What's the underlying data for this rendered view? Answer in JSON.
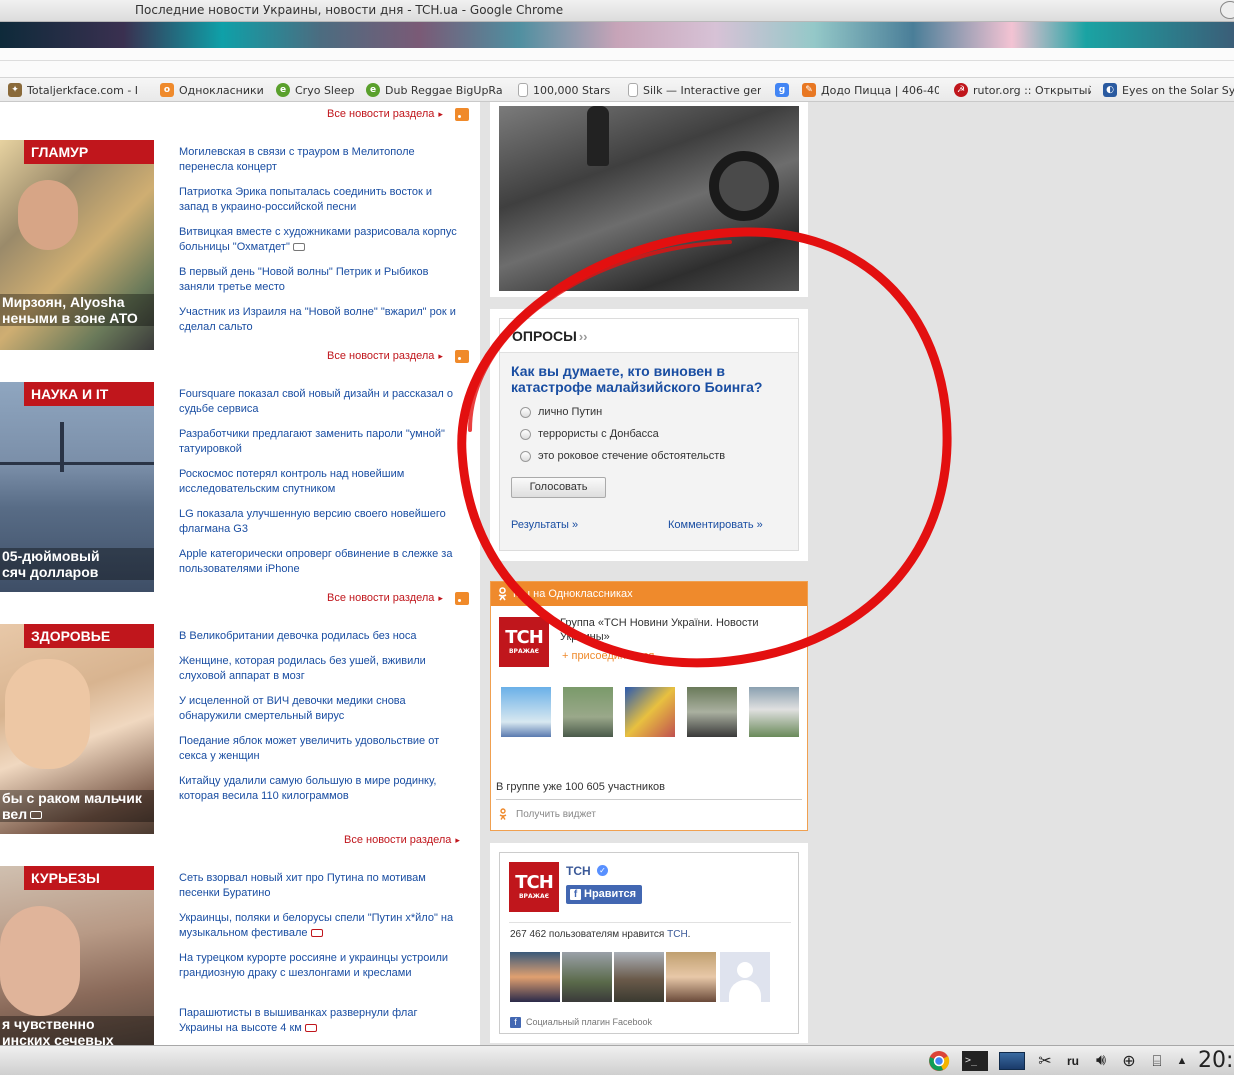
{
  "window": {
    "title": "Последние новости Украины, новости дня - TCH.ua - Google Chrome"
  },
  "bookmarks": [
    {
      "label": "Totaljerkface.com - I",
      "icon": "puzzle-icon",
      "color": "#8a6a3a"
    },
    {
      "label": "Однокласники",
      "icon": "odnoklassniki-icon",
      "color": "#ef8a2c"
    },
    {
      "label": "Cryo Sleep",
      "icon": "e-icon",
      "color": "#5aa02c"
    },
    {
      "label": "Dub Reggae BigUpRa",
      "icon": "e-icon",
      "color": "#5aa02c"
    },
    {
      "label": "100,000 Stars",
      "icon": "page-icon",
      "color": "#bbbbbb"
    },
    {
      "label": "Silk — Interactive gen",
      "icon": "page-icon",
      "color": "#bbbbbb"
    },
    {
      "label": "",
      "icon": "google-icon",
      "color": "#4285f4"
    },
    {
      "label": "Додо Пицца | 406-40",
      "icon": "dodo-icon",
      "color": "#e87722"
    },
    {
      "label": "rutor.org :: Открытый",
      "icon": "rutor-icon",
      "color": "#c0161c"
    },
    {
      "label": "Eyes on the Solar Sys",
      "icon": "nasa-icon",
      "color": "#2a5aa0"
    }
  ],
  "sections": [
    {
      "label": "",
      "caption": [],
      "items": [],
      "all_news": "Все новости раздела"
    },
    {
      "label": "ГЛАМУР",
      "caption": [
        "Мирзоян, Alyosha",
        "неными в зоне АТО"
      ],
      "items": [
        {
          "text": "Могилевская в связи с трауром в Мелитополе перенесла концерт",
          "badge": ""
        },
        {
          "text": "Патриотка Эрика попыталась соединить восток и запад в украино-российской песни",
          "badge": ""
        },
        {
          "text": "Витвицкая вместе с художниками разрисовала корпус больницы \"Охматдет\"",
          "badge": "photo"
        },
        {
          "text": "В первый день \"Новой волны\" Петрик и Рыбиков заняли третье место",
          "badge": ""
        },
        {
          "text": "Участник из Израиля на \"Новой волне\" \"вжарил\" рок и сделал сальто",
          "badge": ""
        }
      ],
      "all_news": "Все новости раздела"
    },
    {
      "label": "НАУКА И IT",
      "caption": [
        "05-дюймовый",
        "сяч долларов"
      ],
      "items": [
        {
          "text": "Foursquare показал свой новый дизайн и рассказал о судьбе сервиса",
          "badge": ""
        },
        {
          "text": "Разработчики предлагают заменить пароли \"умной\" татуировкой",
          "badge": ""
        },
        {
          "text": "Роскосмос потерял контроль над новейшим исследовательским спутником",
          "badge": ""
        },
        {
          "text": "LG показала улучшенную версию своего новейшего флагмана G3",
          "badge": ""
        },
        {
          "text": "Apple категорически опроверг обвинение в слежке за пользователями iPhone",
          "badge": ""
        }
      ],
      "all_news": "Все новости раздела"
    },
    {
      "label": "ЗДОРОВЬЕ",
      "caption": [
        "бы с раком мальчик",
        "вел"
      ],
      "items": [
        {
          "text": "В Великобритании девочка родилась без носа",
          "badge": ""
        },
        {
          "text": "Женщине, которая родилась без ушей, вживили слуховой аппарат в мозг",
          "badge": ""
        },
        {
          "text": "У исцеленной от ВИЧ девочки медики снова обнаружили смертельный вирус",
          "badge": ""
        },
        {
          "text": "Поедание яблок может увеличить удовольствие от секса у женщин",
          "badge": ""
        },
        {
          "text": "Китайцу удалили самую большую в мире родинку, которая весила 110 килограммов",
          "badge": ""
        }
      ],
      "all_news": "Все новости раздела"
    },
    {
      "label": "КУРЬЕЗЫ",
      "caption": [
        "я чувственно",
        "инских сечевых"
      ],
      "items": [
        {
          "text": "Сеть взорвал новый хит про Путина по мотивам песенки Буратино",
          "badge": ""
        },
        {
          "text": "Украинцы, поляки и белорусы спели \"Путин х*йло\" на музыкальном фестивале",
          "badge": "video"
        },
        {
          "text": "На турецком курорте россияне и украинцы устроили грандиозную драку с шезлонгами и креслами",
          "badge": ""
        },
        {
          "text": "Парашютисты в вышиванках развернули флаг Украины на высоте 4 км",
          "badge": "video"
        }
      ],
      "all_news": ""
    }
  ],
  "poll": {
    "title": "ОПРОСЫ",
    "question": "Как вы думаете, кто виновен в катастрофе малайзийского Боинга?",
    "options": [
      "лично Путин",
      "террористы с Донбасса",
      "это роковое стечение обстоятельств"
    ],
    "vote_label": "Голосовать",
    "results_link": "Результаты »",
    "comment_link": "Комментировать »"
  },
  "ok_widget": {
    "header": "Мы на Одноклассниках",
    "group_name": "Группа «ТСН Новини України. Новости Украины»",
    "join_label": "присоединиться",
    "members": "В группе уже 100 605 участников",
    "get_widget": "Получить виджет"
  },
  "logo": {
    "big": "ТСН",
    "small": "ВРАЖАЄ"
  },
  "fb_widget": {
    "name": "ТСН",
    "like_label": "Нравится",
    "count_prefix": "267 462 пользователям нравится ",
    "count_link": "ТСН",
    "count_suffix": ".",
    "footer": "Социальный плагин Facebook"
  },
  "taskbar": {
    "lang": "ru",
    "clock": "20:"
  },
  "colors": {
    "accent_red": "#c0161c",
    "link_blue": "#1a4ea2",
    "ok_orange": "#ef8a2c",
    "fb_blue": "#4267b2"
  }
}
